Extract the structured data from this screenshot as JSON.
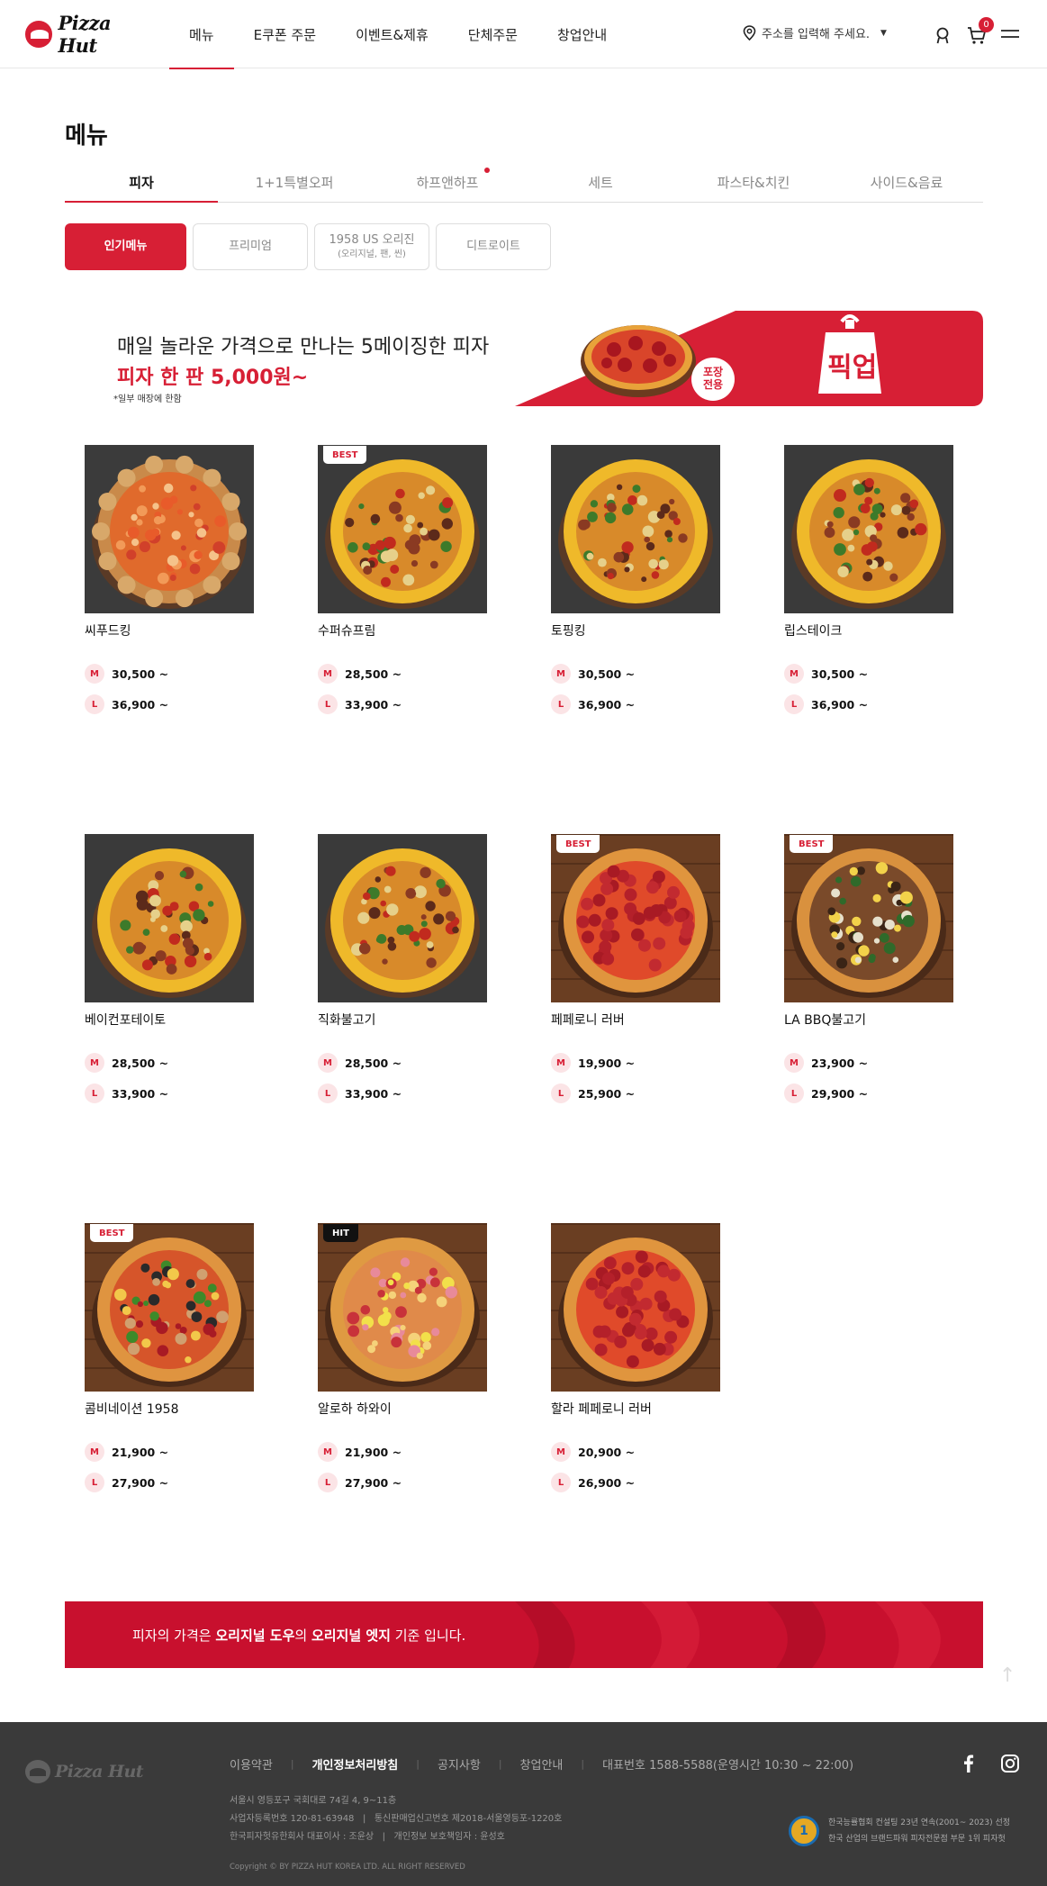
{
  "header": {
    "logo_text": "Pizza Hut",
    "nav": [
      "메뉴",
      "E쿠폰 주문",
      "이벤트&제휴",
      "단체주문",
      "창업안내"
    ],
    "address_placeholder": "주소를 입력해 주세요.",
    "cart_count": "0"
  },
  "page": {
    "title": "메뉴",
    "tabs": [
      "피자",
      "1+1특별오퍼",
      "하프앤하프",
      "세트",
      "파스타&치킨",
      "사이드&음료"
    ],
    "subtabs": [
      {
        "label": "인기메뉴",
        "sub": ""
      },
      {
        "label": "프리미엄",
        "sub": ""
      },
      {
        "label": "1958 US 오리진",
        "sub": "(오리지널, 팬, 씬)"
      },
      {
        "label": "디트로이트",
        "sub": ""
      }
    ]
  },
  "banner": {
    "line1": "매일 놀라운 가격으로 만나는 5메이징한 피자",
    "line2": "피자 한 판 5,000원~",
    "note": "*일부 매장에 한함",
    "badge": "포장\n전용",
    "bag_text": "픽업"
  },
  "size_labels": {
    "m": "M",
    "l": "L"
  },
  "products": [
    {
      "name": "씨푸드킹",
      "m": "30,500 ~",
      "l": "36,900 ~",
      "tag": "",
      "crust": "shrimp"
    },
    {
      "name": "수퍼슈프림",
      "m": "28,500 ~",
      "l": "33,900 ~",
      "tag": "BEST",
      "crust": "gold"
    },
    {
      "name": "토핑킹",
      "m": "30,500 ~",
      "l": "36,900 ~",
      "tag": "",
      "crust": "gold"
    },
    {
      "name": "립스테이크",
      "m": "30,500 ~",
      "l": "36,900 ~",
      "tag": "",
      "crust": "gold"
    },
    {
      "name": "베이컨포테이토",
      "m": "28,500 ~",
      "l": "33,900 ~",
      "tag": "",
      "crust": "gold"
    },
    {
      "name": "직화불고기",
      "m": "28,500 ~",
      "l": "33,900 ~",
      "tag": "",
      "crust": "gold"
    },
    {
      "name": "페페로니 러버",
      "m": "19,900 ~",
      "l": "25,900 ~",
      "tag": "BEST",
      "crust": "pepperoni"
    },
    {
      "name": "LA BBQ불고기",
      "m": "23,900 ~",
      "l": "29,900 ~",
      "tag": "BEST",
      "crust": "bbq"
    },
    {
      "name": "콤비네이션 1958",
      "m": "21,900 ~",
      "l": "27,900 ~",
      "tag": "BEST",
      "crust": "combo"
    },
    {
      "name": "알로하 하와이",
      "m": "21,900 ~",
      "l": "27,900 ~",
      "tag": "HIT",
      "crust": "hawaii"
    },
    {
      "name": "할라 페페로니 러버",
      "m": "20,900 ~",
      "l": "26,900 ~",
      "tag": "",
      "crust": "pepperoni"
    }
  ],
  "notice": {
    "pre": "피자의 가격은 ",
    "b1": "오리지널 도우",
    "mid": "의 ",
    "b2": "오리지널 엣지",
    "post": " 기준 입니다."
  },
  "footer": {
    "logo_text": "Pizza Hut",
    "links": [
      "이용약관",
      "개인정보처리방침",
      "공지사항",
      "창업안내"
    ],
    "phone": "대표번호 1588-5588(운영시간 10:30 ~ 22:00)",
    "info1": "서울시 영등포구 국회대로 74길 4, 9~11층",
    "info2": "사업자등록번호 120-81-63948   |   통신판매업신고번호 제2018-서울영등포-1220호",
    "info3": "한국피자헛유한회사 대표이사 : 조윤상   |   개인정보 보호책임자 : 윤성호",
    "copyright": "Copyright © BY PIZZA HUT KOREA LTD. ALL RIGHT RESERVED",
    "award_mark": "1",
    "award_line1": "한국능률협회 컨설팅 23년 연속(2001~ 2023) 선정",
    "award_line2": "한국 산업의 브랜드파워 피자전문점 부문 1위 피자헛"
  },
  "colors": {
    "brand": "#d71f35",
    "notice": "#c8102e",
    "footer": "#3a3a3a"
  }
}
